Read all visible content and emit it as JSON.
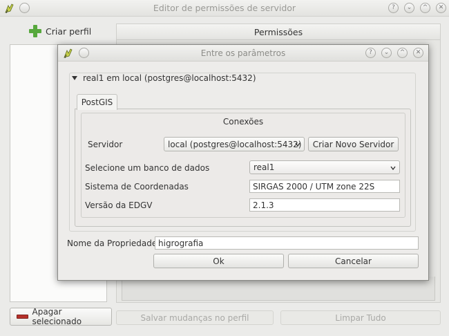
{
  "background_window": {
    "title": "Editor de permissões de servidor",
    "create_profile_label": "Criar perfil",
    "permissions_header": "Permissões",
    "delete_selected_label": "Apagar selecionado",
    "save_changes_label": "Salvar mudanças no perfil",
    "clear_all_label": "Limpar Tudo"
  },
  "dialog": {
    "title": "Entre os parâmetros",
    "tree_node": "real1 em local (postgres@localhost:5432)",
    "tab_label": "PostGIS",
    "connections_title": "Conexões",
    "server_label": "Servidor",
    "server_value": "local (postgres@localhost:5432)",
    "new_server_button": "Criar Novo Servidor",
    "database_label": "Selecione um banco de dados",
    "database_value": "real1",
    "crs_label": "Sistema de Coordenadas",
    "crs_value": "SIRGAS 2000 / UTM zone 22S",
    "edgv_label": "Versão da EDGV",
    "edgv_value": "2.1.3",
    "property_label": "Nome da Propriedade",
    "property_value": "higrografia",
    "ok_label": "Ok",
    "cancel_label": "Cancelar"
  },
  "colors": {
    "accent_green": "#57a83d",
    "delete_red": "#b5302a"
  }
}
